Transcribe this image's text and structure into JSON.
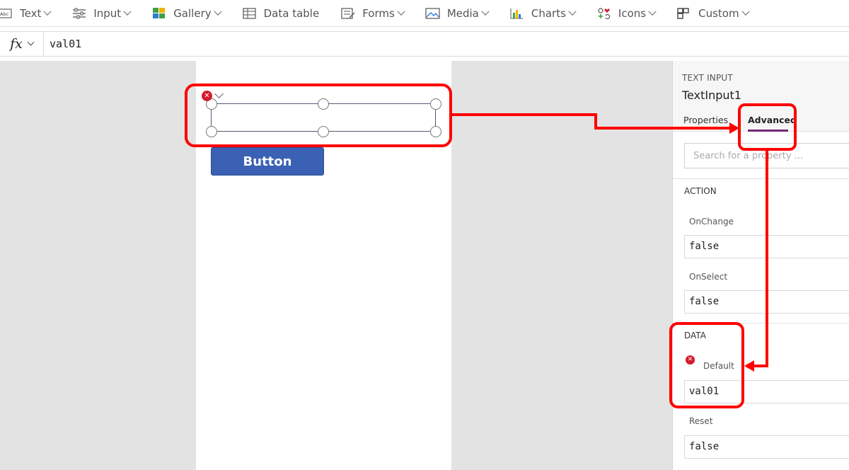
{
  "ribbon": {
    "items": [
      {
        "label": "Text",
        "icon": "text-label-icon"
      },
      {
        "label": "Input",
        "icon": "sliders-icon"
      },
      {
        "label": "Gallery",
        "icon": "gallery-grid-icon"
      },
      {
        "label": "Data table",
        "icon": "table-icon"
      },
      {
        "label": "Forms",
        "icon": "form-icon"
      },
      {
        "label": "Media",
        "icon": "image-icon"
      },
      {
        "label": "Charts",
        "icon": "bar-chart-icon"
      },
      {
        "label": "Icons",
        "icon": "icons-icon"
      },
      {
        "label": "Custom",
        "icon": "component-icon"
      }
    ]
  },
  "formula": {
    "fx_label": "fx",
    "value": "val01"
  },
  "canvas": {
    "button_label": "Button"
  },
  "panel": {
    "control_type": "TEXT INPUT",
    "control_name": "TextInput1",
    "tabs": {
      "properties": "Properties",
      "advanced": "Advanced"
    },
    "search_placeholder": "Search for a property ...",
    "sections": {
      "action": {
        "title": "ACTION",
        "on_change_label": "OnChange",
        "on_change_value": "false",
        "on_select_label": "OnSelect",
        "on_select_value": "false"
      },
      "data": {
        "title": "DATA",
        "default_label": "Default",
        "default_value": "val01",
        "reset_label": "Reset",
        "reset_value": "false"
      }
    }
  },
  "colors": {
    "highlight": "#ff0000",
    "accent": "#742774",
    "button": "#3b61b4",
    "error": "#d41b2c"
  }
}
